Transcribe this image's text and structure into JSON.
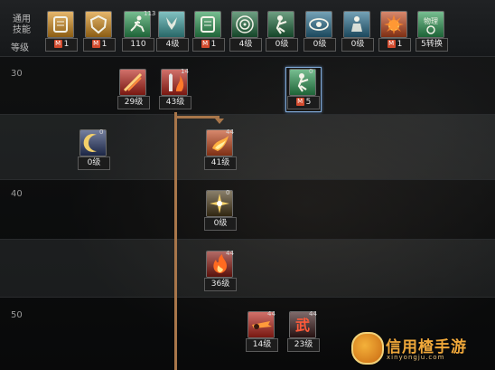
{
  "header": {
    "general_label_1": "通用",
    "general_label_2": "技能",
    "level_label": "等级"
  },
  "top_skills": [
    {
      "name": "skill-1",
      "badge": "1",
      "m": true,
      "mini": "",
      "color": "#d8901e",
      "icon": "scroll-icon"
    },
    {
      "name": "skill-2",
      "badge": "1",
      "m": true,
      "mini": "",
      "color": "#d8901e",
      "icon": "shield-icon"
    },
    {
      "name": "skill-3",
      "badge": "110",
      "m": false,
      "mini": "113",
      "color": "#2e9a55",
      "icon": "runner-icon"
    },
    {
      "name": "skill-4",
      "badge": "4级",
      "m": false,
      "mini": "",
      "color": "#3ea0a0",
      "icon": "wing-icon"
    },
    {
      "name": "skill-5",
      "badge": "1",
      "m": true,
      "mini": "",
      "color": "#2e9a55",
      "icon": "scroll-icon"
    },
    {
      "name": "skill-6",
      "badge": "4级",
      "m": false,
      "mini": "",
      "color": "#1f6b3e",
      "icon": "target-icon"
    },
    {
      "name": "skill-7",
      "badge": "0级",
      "m": false,
      "mini": "",
      "color": "#1f6b3e",
      "icon": "fighter-icon"
    },
    {
      "name": "skill-8",
      "badge": "0级",
      "m": false,
      "mini": "",
      "color": "#2a6f8f",
      "icon": "eye-icon"
    },
    {
      "name": "skill-9",
      "badge": "0级",
      "m": false,
      "mini": "",
      "color": "#2a6f8f",
      "icon": "figure-icon"
    },
    {
      "name": "skill-10",
      "badge": "1",
      "m": true,
      "mini": "",
      "color": "#c2481e",
      "icon": "burst-icon"
    },
    {
      "name": "skill-11",
      "badge": "5转换",
      "m": false,
      "mini": "",
      "color": "#2e9a55",
      "icon": "physics-icon",
      "icon_text": "物理"
    }
  ],
  "levels": [
    "30",
    "40",
    "50"
  ],
  "tree_skills": [
    {
      "name": "tree-skill-29",
      "badge": "29级",
      "color": "#b8241a",
      "icon": "slash-icon"
    },
    {
      "name": "tree-skill-43",
      "badge": "43级",
      "color": "#b8241a",
      "icon": "flame-sword-icon",
      "mini": "14"
    },
    {
      "name": "tree-skill-m5",
      "badge": "5",
      "m": true,
      "color": "#2e9a55",
      "icon": "fighter-icon",
      "mini": "0"
    },
    {
      "name": "tree-skill-moon",
      "badge": "0级",
      "color": "#2b3b6b",
      "icon": "moon-icon",
      "mini": "0"
    },
    {
      "name": "tree-skill-41",
      "badge": "41级",
      "color": "#c2481e",
      "icon": "flame-icon",
      "mini": "44"
    },
    {
      "name": "tree-skill-star",
      "badge": "0级",
      "color": "#4a3a1a",
      "icon": "star-icon",
      "mini": "0"
    },
    {
      "name": "tree-skill-36",
      "badge": "36级",
      "color": "#8a1a12",
      "icon": "fire-icon",
      "mini": "44"
    },
    {
      "name": "tree-skill-14",
      "badge": "14级",
      "color": "#b8241a",
      "icon": "strike-icon",
      "mini": "44"
    },
    {
      "name": "tree-skill-23",
      "badge": "23级",
      "color": "#3a1a1a",
      "icon": "kanji-icon",
      "mini": "44",
      "icon_text": "武"
    }
  ],
  "watermark": {
    "title": "信用楂手游",
    "sub": "xinyongju.com"
  },
  "colors": {
    "arrow": "#a8764a",
    "m_tag": "#d24b2e",
    "highlight": "#7fa8d6"
  }
}
